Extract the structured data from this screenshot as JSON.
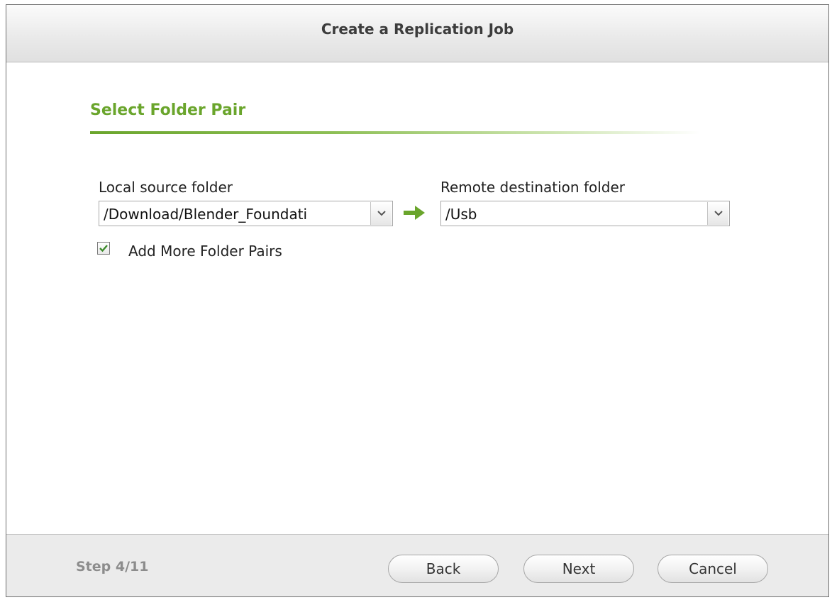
{
  "dialog": {
    "title": "Create a Replication Job"
  },
  "section": {
    "title": "Select Folder Pair"
  },
  "source": {
    "label": "Local source folder",
    "value": "/Download/Blender_Foundati"
  },
  "destination": {
    "label": "Remote destination folder",
    "value": "/Usb"
  },
  "add_more": {
    "label": "Add More Folder Pairs",
    "checked": true
  },
  "footer": {
    "step": "Step 4/11",
    "back_label": "Back",
    "next_label": "Next",
    "cancel_label": "Cancel"
  },
  "colors": {
    "accent": "#6aa52c"
  },
  "icons": {
    "dropdown": "chevron-down-icon",
    "arrow": "arrow-right-icon",
    "check": "check-icon"
  }
}
